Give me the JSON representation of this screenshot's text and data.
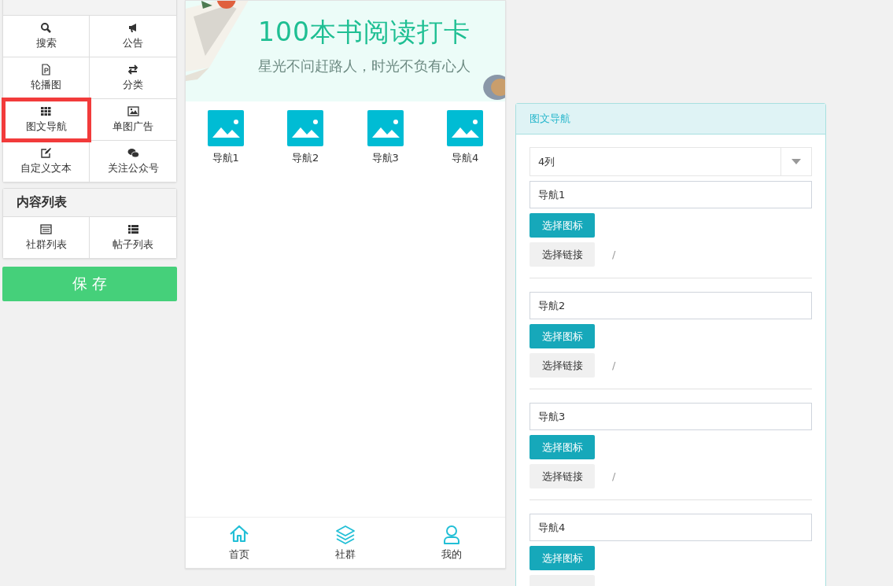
{
  "sidebar": {
    "sections": [
      {
        "items": [
          {
            "label": "搜索",
            "highlighted": false
          },
          {
            "label": "公告",
            "highlighted": false
          },
          {
            "label": "轮播图",
            "highlighted": false
          },
          {
            "label": "分类",
            "highlighted": false
          },
          {
            "label": "图文导航",
            "highlighted": true
          },
          {
            "label": "单图广告",
            "highlighted": false
          },
          {
            "label": "自定义文本",
            "highlighted": false
          },
          {
            "label": "关注公众号",
            "highlighted": false
          }
        ]
      },
      {
        "title": "内容列表",
        "items": [
          {
            "label": "社群列表",
            "highlighted": false
          },
          {
            "label": "帖子列表",
            "highlighted": false
          }
        ]
      }
    ],
    "save_button": "保 存"
  },
  "phone": {
    "banner": {
      "title": "100本书阅读打卡",
      "subtitle": "星光不问赶路人，时光不负有心人"
    },
    "nav_items": [
      {
        "label": "导航1"
      },
      {
        "label": "导航2"
      },
      {
        "label": "导航3"
      },
      {
        "label": "导航4"
      }
    ],
    "tab_bar": [
      {
        "label": "首页"
      },
      {
        "label": "社群"
      },
      {
        "label": "我的"
      }
    ]
  },
  "editor": {
    "title": "图文导航",
    "columns_select": "4列",
    "items": [
      {
        "name": "导航1",
        "icon_button": "选择图标",
        "link_button": "选择链接",
        "link": "/"
      },
      {
        "name": "导航2",
        "icon_button": "选择图标",
        "link_button": "选择链接",
        "link": "/"
      },
      {
        "name": "导航3",
        "icon_button": "选择图标",
        "link_button": "选择链接",
        "link": "/"
      },
      {
        "name": "导航4",
        "icon_button": "选择图标"
      }
    ]
  }
}
